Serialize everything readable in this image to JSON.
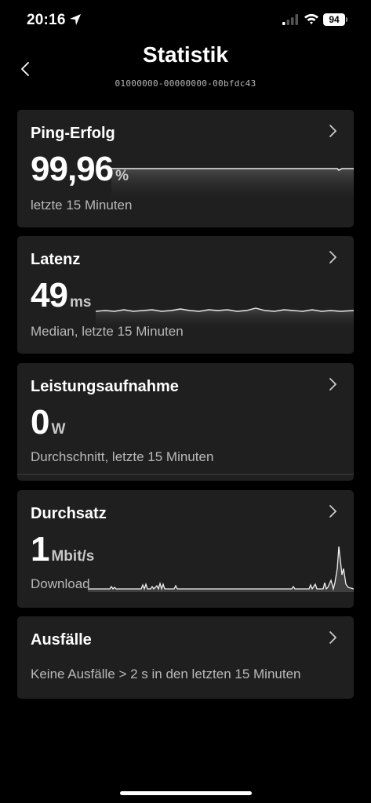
{
  "status_bar": {
    "time": "20:16",
    "battery": "94"
  },
  "header": {
    "title": "Statistik",
    "device_id": "01000000-00000000-00bfdc43"
  },
  "cards": [
    {
      "title": "Ping-Erfolg",
      "value": "99,96",
      "unit": "%",
      "caption": "letzte 15 Minuten"
    },
    {
      "title": "Latenz",
      "value": "49",
      "unit": "ms",
      "caption": "Median, letzte 15 Minuten"
    },
    {
      "title": "Leistungsaufnahme",
      "value": "0",
      "unit": "W",
      "caption": "Durchschnitt, letzte 15 Minuten"
    },
    {
      "title": "Durchsatz",
      "value": "1",
      "unit": "Mbit/s",
      "caption": "Download"
    },
    {
      "title": "Ausfälle",
      "caption": "Keine Ausfälle > 2 s in den letzten 15 Minuten"
    }
  ],
  "icons": {
    "back": "chevron-left-icon",
    "card": "chevron-right-icon",
    "location": "location-arrow-icon",
    "signal": "cellular-signal-icon",
    "wifi": "wifi-icon"
  },
  "colors": {
    "background": "#000000",
    "card": "#1f1f1f",
    "text": "#ffffff",
    "muted": "#b9b9b9"
  }
}
